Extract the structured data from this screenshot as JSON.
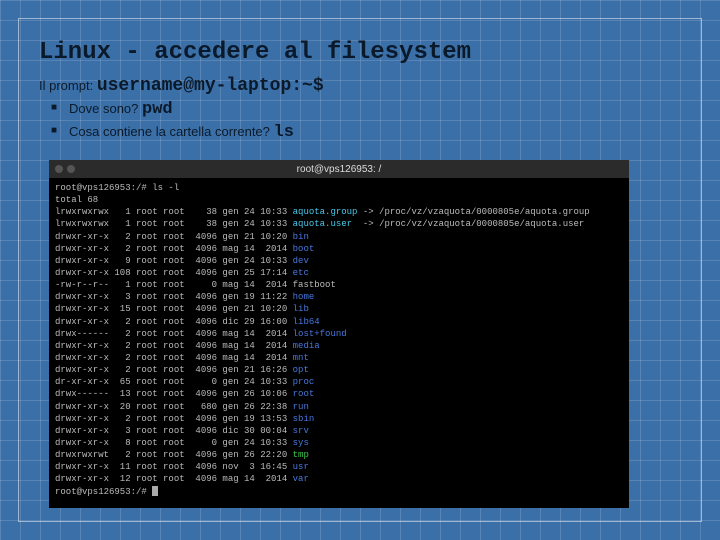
{
  "title": "Linux - accedere al filesystem",
  "prompt_label": "Il prompt:",
  "prompt_value": "username@my-laptop:~$",
  "bullets": [
    {
      "text": "Dove sono?",
      "cmd": "pwd"
    },
    {
      "text": "Cosa contiene la cartella corrente?",
      "cmd": "ls"
    }
  ],
  "terminal": {
    "window_title": "root@vps126953: /",
    "lines": [
      {
        "plain": "root@vps126953:/# ls -l"
      },
      {
        "plain": "total 68"
      },
      {
        "perm": "lrwxrwxrwx",
        "n": "  1",
        "own": "root root",
        "size": "   38",
        "date": "gen 24 10:33",
        "name": "aquota.group",
        "cls": "c-link",
        "extra": " -> /proc/vz/vzaquota/0000805e/aquota.group"
      },
      {
        "perm": "lrwxrwxrwx",
        "n": "  1",
        "own": "root root",
        "size": "   38",
        "date": "gen 24 10:33",
        "name": "aquota.user",
        "cls": "c-link",
        "extra": "  -> /proc/vz/vzaquota/0000805e/aquota.user"
      },
      {
        "perm": "drwxr-xr-x",
        "n": "  2",
        "own": "root root",
        "size": " 4096",
        "date": "gen 21 10:20",
        "name": "bin",
        "cls": "c-dir"
      },
      {
        "perm": "drwxr-xr-x",
        "n": "  2",
        "own": "root root",
        "size": " 4096",
        "date": "mag 14  2014",
        "name": "boot",
        "cls": "c-dir"
      },
      {
        "perm": "drwxr-xr-x",
        "n": "  9",
        "own": "root root",
        "size": " 4096",
        "date": "gen 24 10:33",
        "name": "dev",
        "cls": "c-dir"
      },
      {
        "perm": "drwxr-xr-x",
        "n": "108",
        "own": "root root",
        "size": " 4096",
        "date": "gen 25 17:14",
        "name": "etc",
        "cls": "c-dir"
      },
      {
        "perm": "-rw-r--r--",
        "n": "  1",
        "own": "root root",
        "size": "    0",
        "date": "mag 14  2014",
        "name": "fastboot",
        "cls": ""
      },
      {
        "perm": "drwxr-xr-x",
        "n": "  3",
        "own": "root root",
        "size": " 4096",
        "date": "gen 19 11:22",
        "name": "home",
        "cls": "c-dir"
      },
      {
        "perm": "drwxr-xr-x",
        "n": " 15",
        "own": "root root",
        "size": " 4096",
        "date": "gen 21 10:20",
        "name": "lib",
        "cls": "c-dir"
      },
      {
        "perm": "drwxr-xr-x",
        "n": "  2",
        "own": "root root",
        "size": " 4096",
        "date": "dic 29 16:00",
        "name": "lib64",
        "cls": "c-dir"
      },
      {
        "perm": "drwx------",
        "n": "  2",
        "own": "root root",
        "size": " 4096",
        "date": "mag 14  2014",
        "name": "lost+found",
        "cls": "c-dir"
      },
      {
        "perm": "drwxr-xr-x",
        "n": "  2",
        "own": "root root",
        "size": " 4096",
        "date": "mag 14  2014",
        "name": "media",
        "cls": "c-dir"
      },
      {
        "perm": "drwxr-xr-x",
        "n": "  2",
        "own": "root root",
        "size": " 4096",
        "date": "mag 14  2014",
        "name": "mnt",
        "cls": "c-dir"
      },
      {
        "perm": "drwxr-xr-x",
        "n": "  2",
        "own": "root root",
        "size": " 4096",
        "date": "gen 21 16:26",
        "name": "opt",
        "cls": "c-dir"
      },
      {
        "perm": "dr-xr-xr-x",
        "n": " 65",
        "own": "root root",
        "size": "    0",
        "date": "gen 24 10:33",
        "name": "proc",
        "cls": "c-dir"
      },
      {
        "perm": "drwx------",
        "n": " 13",
        "own": "root root",
        "size": " 4096",
        "date": "gen 26 10:06",
        "name": "root",
        "cls": "c-dir"
      },
      {
        "perm": "drwxr-xr-x",
        "n": " 20",
        "own": "root root",
        "size": "  680",
        "date": "gen 26 22:38",
        "name": "run",
        "cls": "c-dir"
      },
      {
        "perm": "drwxr-xr-x",
        "n": "  2",
        "own": "root root",
        "size": " 4096",
        "date": "gen 19 13:53",
        "name": "sbin",
        "cls": "c-dir"
      },
      {
        "perm": "drwxr-xr-x",
        "n": "  3",
        "own": "root root",
        "size": " 4096",
        "date": "dic 30 00:04",
        "name": "srv",
        "cls": "c-dir"
      },
      {
        "perm": "drwxr-xr-x",
        "n": "  8",
        "own": "root root",
        "size": "    0",
        "date": "gen 24 10:33",
        "name": "sys",
        "cls": "c-dir"
      },
      {
        "perm": "drwxrwxrwt",
        "n": "  2",
        "own": "root root",
        "size": " 4096",
        "date": "gen 26 22:20",
        "name": "tmp",
        "cls": "c-exec"
      },
      {
        "perm": "drwxr-xr-x",
        "n": " 11",
        "own": "root root",
        "size": " 4096",
        "date": "nov  3 16:45",
        "name": "usr",
        "cls": "c-dir"
      },
      {
        "perm": "drwxr-xr-x",
        "n": " 12",
        "own": "root root",
        "size": " 4096",
        "date": "mag 14  2014",
        "name": "var",
        "cls": "c-dir"
      },
      {
        "prompt": "root@vps126953:/# "
      }
    ]
  }
}
